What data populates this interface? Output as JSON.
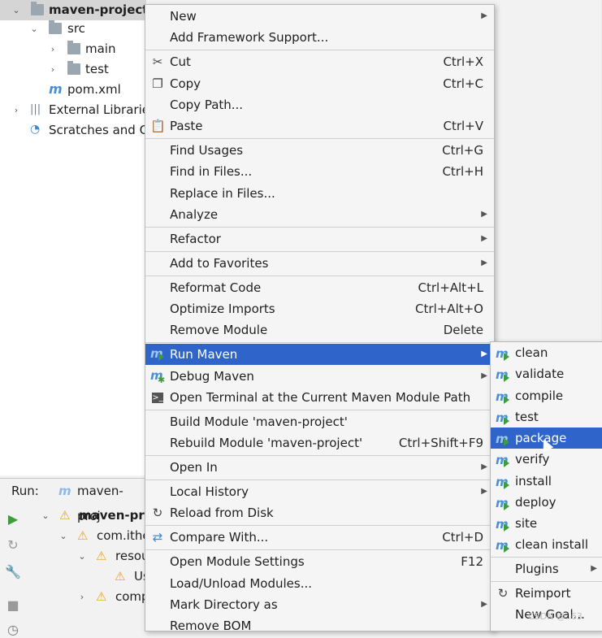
{
  "tree": {
    "project": "maven-project",
    "src": "src",
    "main": "main",
    "test": "test",
    "pom": "pom.xml",
    "external": "External Librarie",
    "scratches": "Scratches and Co"
  },
  "run_panel": {
    "label": "Run:",
    "tab": "maven-proj",
    "rows": [
      "maven-proj",
      "com.ithe",
      "resou",
      "Us",
      "comp"
    ]
  },
  "menu": {
    "items": [
      {
        "label": "New",
        "shortcut": "",
        "submenu": true
      },
      {
        "label": "Add Framework Support...",
        "shortcut": "",
        "submenu": false
      },
      {
        "label": "Cut",
        "shortcut": "Ctrl+X",
        "submenu": false,
        "icon": "scissors-icon"
      },
      {
        "label": "Copy",
        "shortcut": "Ctrl+C",
        "submenu": false,
        "icon": "copy-icon"
      },
      {
        "label": "Copy Path...",
        "shortcut": "",
        "submenu": false
      },
      {
        "label": "Paste",
        "shortcut": "Ctrl+V",
        "submenu": false,
        "icon": "paste-icon"
      },
      {
        "label": "Find Usages",
        "shortcut": "Ctrl+G",
        "submenu": false
      },
      {
        "label": "Find in Files...",
        "shortcut": "Ctrl+H",
        "submenu": false
      },
      {
        "label": "Replace in Files...",
        "shortcut": "",
        "submenu": false
      },
      {
        "label": "Analyze",
        "shortcut": "",
        "submenu": true
      },
      {
        "label": "Refactor",
        "shortcut": "",
        "submenu": true
      },
      {
        "label": "Add to Favorites",
        "shortcut": "",
        "submenu": true
      },
      {
        "label": "Reformat Code",
        "shortcut": "Ctrl+Alt+L",
        "submenu": false
      },
      {
        "label": "Optimize Imports",
        "shortcut": "Ctrl+Alt+O",
        "submenu": false
      },
      {
        "label": "Remove Module",
        "shortcut": "Delete",
        "submenu": false
      },
      {
        "label": "Run Maven",
        "shortcut": "",
        "submenu": true,
        "icon": "maven-run-icon"
      },
      {
        "label": "Debug Maven",
        "shortcut": "",
        "submenu": true,
        "icon": "maven-debug-icon"
      },
      {
        "label": "Open Terminal at the Current Maven Module Path",
        "shortcut": "",
        "submenu": false,
        "icon": "terminal-icon"
      },
      {
        "label": "Build Module 'maven-project'",
        "shortcut": "",
        "submenu": false
      },
      {
        "label": "Rebuild Module 'maven-project'",
        "shortcut": "Ctrl+Shift+F9",
        "submenu": false
      },
      {
        "label": "Open In",
        "shortcut": "",
        "submenu": true
      },
      {
        "label": "Local History",
        "shortcut": "",
        "submenu": true
      },
      {
        "label": "Reload from Disk",
        "shortcut": "",
        "submenu": false,
        "icon": "reload-icon"
      },
      {
        "label": "Compare With...",
        "shortcut": "Ctrl+D",
        "submenu": false,
        "icon": "compare-icon"
      },
      {
        "label": "Open Module Settings",
        "shortcut": "F12",
        "submenu": false
      },
      {
        "label": "Load/Unload Modules...",
        "shortcut": "",
        "submenu": false
      },
      {
        "label": "Mark Directory as",
        "shortcut": "",
        "submenu": true
      },
      {
        "label": "Remove BOM",
        "shortcut": "",
        "submenu": false
      }
    ],
    "highlighted": "Run Maven"
  },
  "submenu": {
    "items": [
      {
        "label": "clean"
      },
      {
        "label": "validate"
      },
      {
        "label": "compile"
      },
      {
        "label": "test"
      },
      {
        "label": "package"
      },
      {
        "label": "verify"
      },
      {
        "label": "install"
      },
      {
        "label": "deploy"
      },
      {
        "label": "site"
      },
      {
        "label": "clean install"
      },
      {
        "label": "Plugins"
      },
      {
        "label": "Reimport"
      },
      {
        "label": "New Goal..."
      }
    ],
    "highlighted": "package"
  },
  "colors": {
    "highlight": "#2f65ca",
    "maven_blue": "#4a8fd6",
    "run_green": "#3d9c3d"
  },
  "watermark": "CSDN @..63"
}
